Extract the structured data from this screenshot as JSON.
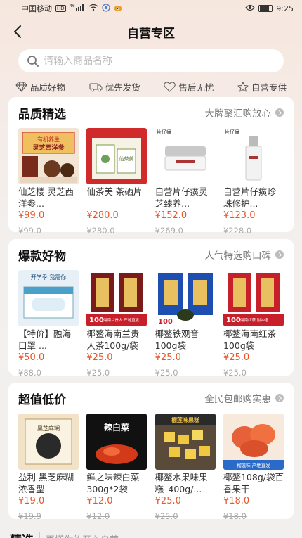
{
  "status_bar": {
    "carrier": "中国移动",
    "hd": "HD",
    "signal": "⁴⁶",
    "time": "9:25"
  },
  "nav": {
    "title": "自营专区"
  },
  "search": {
    "placeholder": "请输入商品名称"
  },
  "features": [
    {
      "label": "品质好物",
      "icon": "diamond-icon"
    },
    {
      "label": "优先发货",
      "icon": "truck-icon"
    },
    {
      "label": "售后无忧",
      "icon": "heart-icon"
    },
    {
      "label": "自营专供",
      "icon": "star-icon"
    }
  ],
  "sections": [
    {
      "title": "品质精选",
      "more": "大牌聚汇购放心",
      "products": [
        {
          "name": "仙芝楼 灵芝西洋参...",
          "price": "¥99.0",
          "orig": "¥99.0",
          "img_label": "灵芝西洋参",
          "img_sub": "有机养生"
        },
        {
          "name": "仙茶美 茶硒片",
          "price": "¥280.0",
          "orig": "¥280.0",
          "img_label": "仙茶美"
        },
        {
          "name": "自营片仔癀灵芝臻养...",
          "price": "¥152.0",
          "orig": "¥269.0",
          "img_label": "片仔癀"
        },
        {
          "name": "自营片仔癀珍珠修护...",
          "price": "¥123.0",
          "orig": "¥228.0",
          "img_label": "片仔癀"
        }
      ]
    },
    {
      "title": "爆款好物",
      "more": "人气特选购口碑",
      "products": [
        {
          "name": "【特价】融海口罩 ...",
          "price": "¥50.0",
          "orig": "¥88.0",
          "img_label": "开学季 我需你"
        },
        {
          "name": "椰鳌海南兰贵人茶100g/袋",
          "price": "¥25.0",
          "orig": "¥25.0",
          "img_label": "海南兰贵人",
          "badge": "100",
          "strip": "海南兰贵人 产地直发"
        },
        {
          "name": "椰鳌铁观音100g袋",
          "price": "¥25.0",
          "orig": "¥25.0",
          "img_label": "铁观音",
          "badge": "100"
        },
        {
          "name": "椰鳌海南红茶100g袋",
          "price": "¥25.0",
          "orig": "¥25.0",
          "img_label": "海南红茶",
          "badge": "100",
          "strip": "海南红茶 耐冲泡"
        }
      ]
    },
    {
      "title": "超值低价",
      "more": "全民包邮购实惠",
      "products": [
        {
          "name": "益利 黑芝麻糊 浓香型",
          "price": "¥19.0",
          "orig": "¥19.9",
          "img_label": "黑芝麻糊"
        },
        {
          "name": "鲜之味辣白菜300g*2袋",
          "price": "¥12.0",
          "orig": "¥12.0",
          "img_label": "辣白菜"
        },
        {
          "name": "椰鳌水果味果糕_400g/...",
          "price": "¥25.0",
          "orig": "¥25.0",
          "img_label": "榴莲味果糕"
        },
        {
          "name": "椰鳌108g/袋百香果干",
          "price": "¥18.0",
          "orig": "¥18.0",
          "img_label": "榴莲味 产地直发"
        }
      ]
    }
  ],
  "bottom": {
    "title": "精选",
    "subtitle": "再懂你的开心自营"
  },
  "colors": {
    "price": "#e6562a",
    "accent_red": "#c8202a",
    "tea_blue": "#1e4fb0"
  }
}
